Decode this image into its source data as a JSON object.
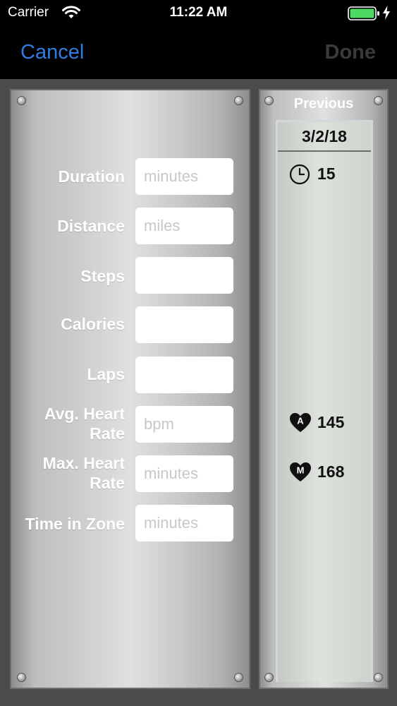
{
  "status_bar": {
    "carrier": "Carrier",
    "time": "11:22 AM"
  },
  "nav": {
    "cancel_label": "Cancel",
    "done_label": "Done"
  },
  "form": {
    "duration": {
      "label": "Duration",
      "placeholder": "minutes"
    },
    "distance": {
      "label": "Distance",
      "placeholder": "miles"
    },
    "steps": {
      "label": "Steps",
      "placeholder": ""
    },
    "calories": {
      "label": "Calories",
      "placeholder": ""
    },
    "laps": {
      "label": "Laps",
      "placeholder": ""
    },
    "avg_heart_rate": {
      "label_line1": "Avg. Heart",
      "label_line2": "Rate",
      "placeholder": "bpm"
    },
    "max_heart_rate": {
      "label_line1": "Max. Heart",
      "label_line2": "Rate",
      "placeholder": "minutes"
    },
    "time_in_zone": {
      "label": "Time in Zone",
      "placeholder": "minutes"
    }
  },
  "previous": {
    "title": "Previous",
    "date": "3/2/18",
    "duration_value": "15",
    "avg_hr_badge": "A",
    "avg_hr_value": "145",
    "max_hr_badge": "M",
    "max_hr_value": "168"
  },
  "colors": {
    "accent": "#2f7de1",
    "battery": "#4cd964"
  }
}
